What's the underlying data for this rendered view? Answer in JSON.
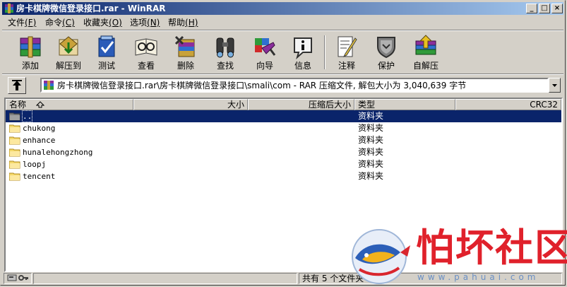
{
  "window": {
    "title": "房卡棋牌微信登录接口.rar - WinRAR",
    "buttons": {
      "minimize": "_",
      "maximize": "□",
      "close": "×"
    }
  },
  "menu": [
    {
      "label": "文件",
      "key": "(F)"
    },
    {
      "label": "命令",
      "key": "(C)"
    },
    {
      "label": "收藏夹",
      "key": "(O)"
    },
    {
      "label": "选项",
      "key": "(N)"
    },
    {
      "label": "帮助",
      "key": "(H)"
    }
  ],
  "toolbar": [
    {
      "label": "添加",
      "icon": "add-books-icon"
    },
    {
      "label": "解压到",
      "icon": "extract-to-icon"
    },
    {
      "label": "测试",
      "icon": "test-icon"
    },
    {
      "label": "查看",
      "icon": "view-icon"
    },
    {
      "label": "删除",
      "icon": "delete-icon"
    },
    {
      "label": "查找",
      "icon": "find-icon"
    },
    {
      "label": "向导",
      "icon": "wizard-icon"
    },
    {
      "label": "信息",
      "icon": "info-icon"
    },
    {
      "label": "注释",
      "icon": "comment-icon"
    },
    {
      "label": "保护",
      "icon": "protect-icon"
    },
    {
      "label": "自解压",
      "icon": "sfx-icon"
    }
  ],
  "address": {
    "path": "房卡棋牌微信登录接口.rar\\房卡棋牌微信登录接口\\smali\\com - RAR 压缩文件, 解包大小为 3,040,639 字节"
  },
  "columns": {
    "name": "名称",
    "size": "大小",
    "packed": "压缩后大小",
    "type": "类型",
    "crc": "CRC32"
  },
  "files": [
    {
      "name": "..",
      "type": "资料夹",
      "selected": true,
      "parent": true
    },
    {
      "name": "chukong",
      "type": "资料夹"
    },
    {
      "name": "enhance",
      "type": "资料夹"
    },
    {
      "name": "hunalehongzhong",
      "type": "资料夹"
    },
    {
      "name": "loopj",
      "type": "资料夹"
    },
    {
      "name": "tencent",
      "type": "资料夹"
    }
  ],
  "status": {
    "summary": "共有 5 个文件夹"
  },
  "watermark": {
    "text": "怕坏社区",
    "url": "www.pahuai.com"
  },
  "colors": {
    "titlebar_start": "#0a246a",
    "titlebar_end": "#a6caf0",
    "selection": "#0a246a",
    "folder": "#f5d96b",
    "watermark": "#e0212b"
  }
}
